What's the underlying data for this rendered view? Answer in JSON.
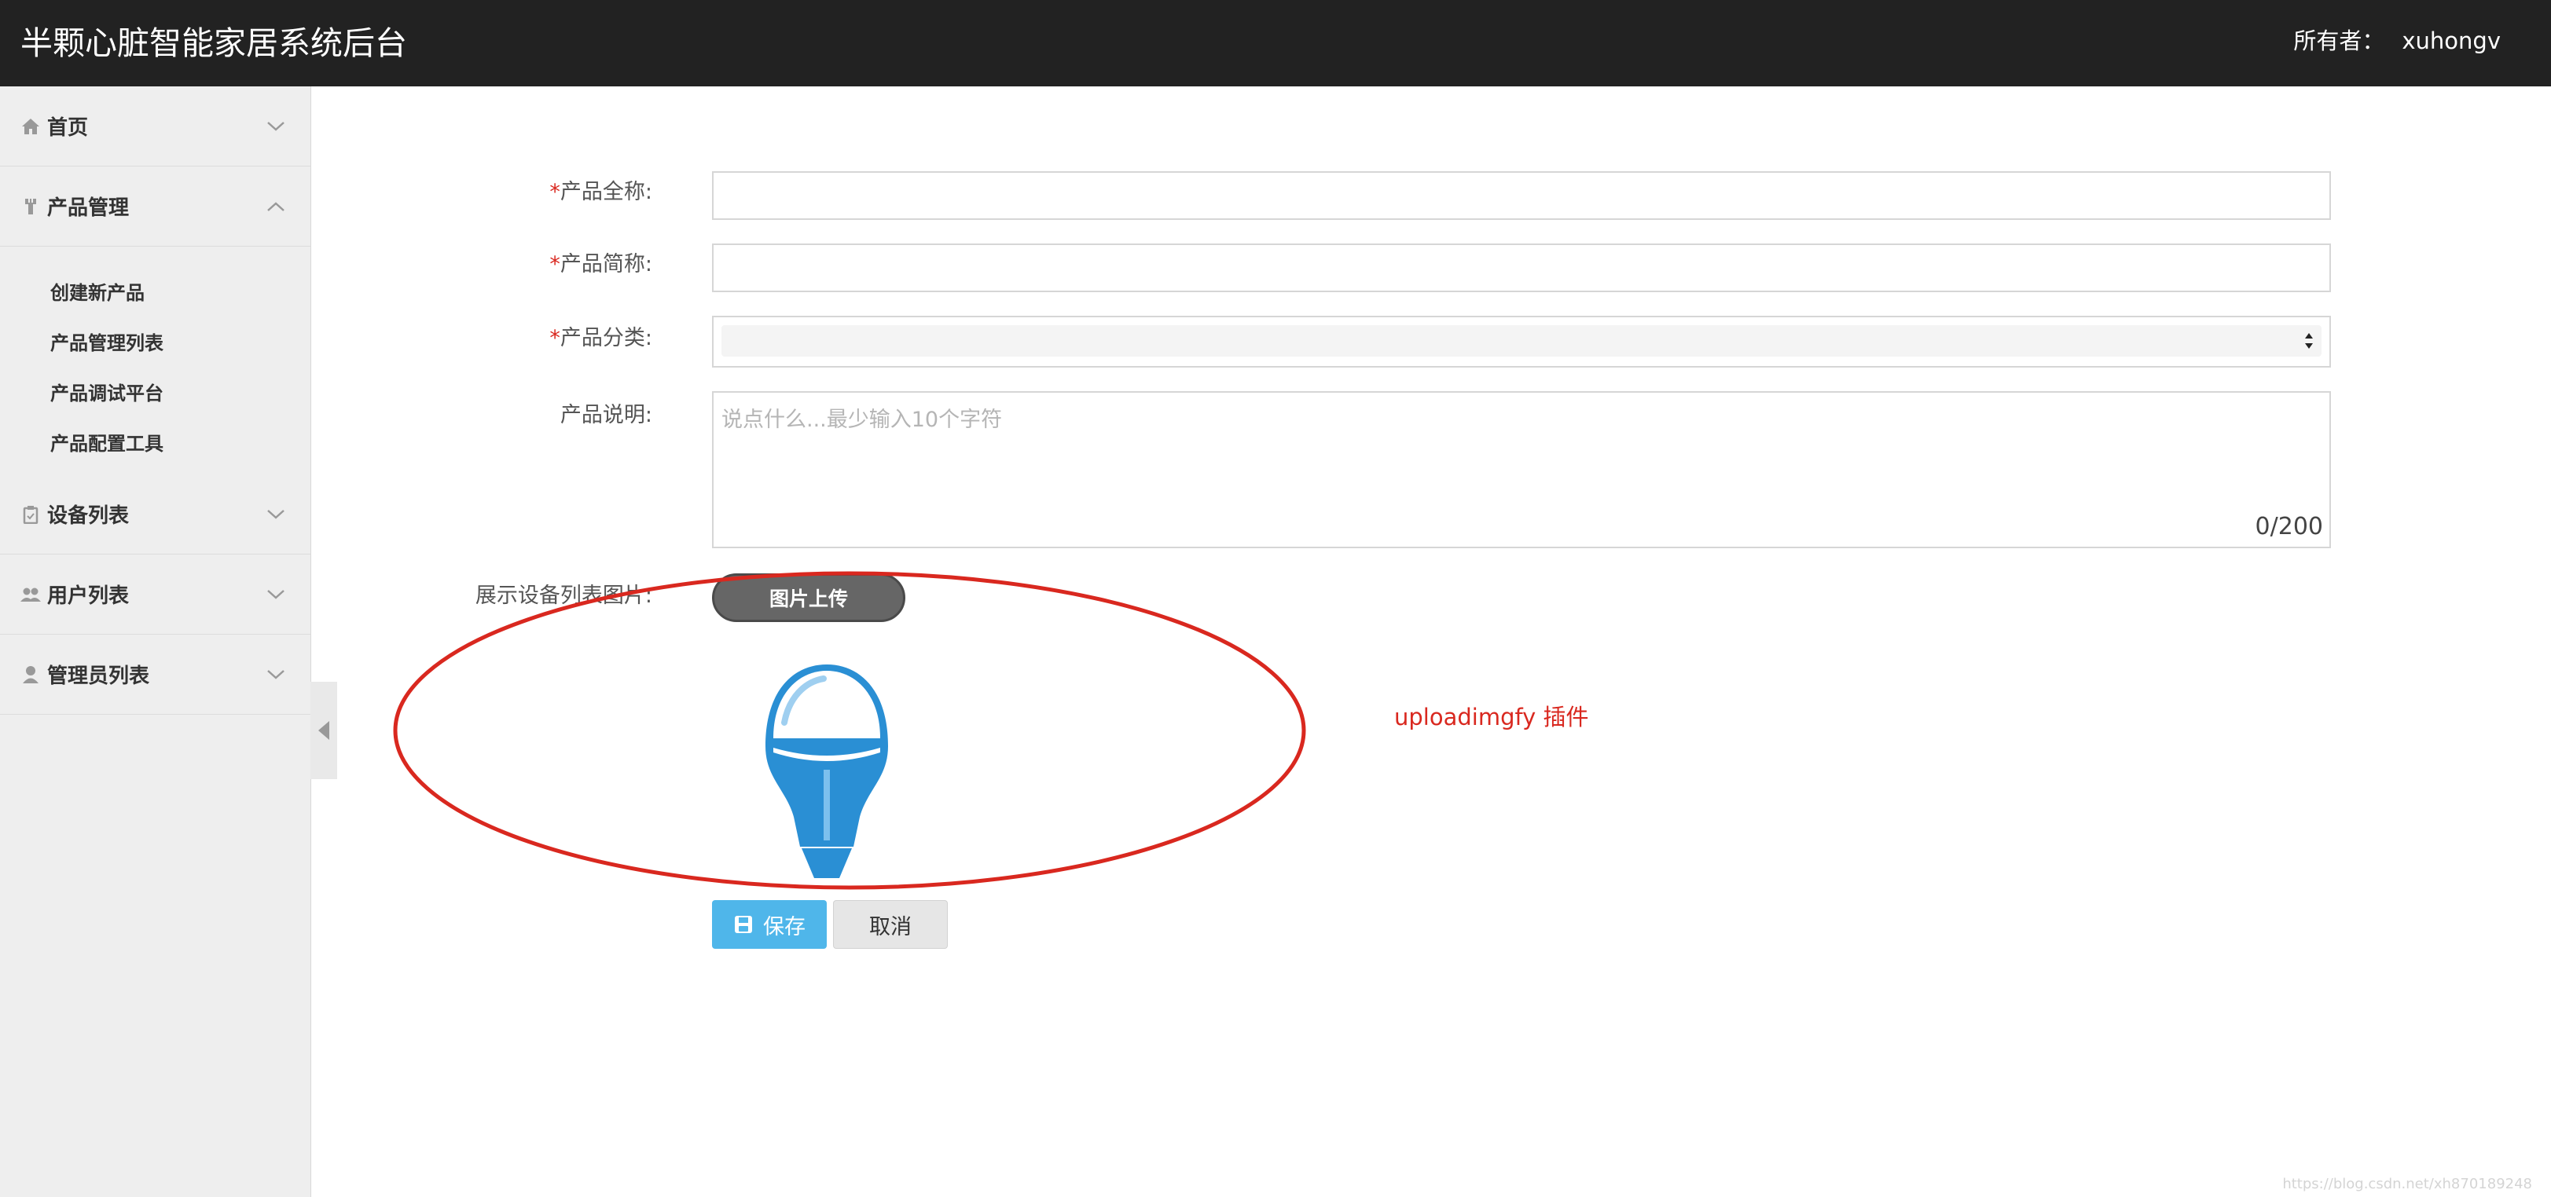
{
  "header": {
    "title": "半颗心脏智能家居系统后台",
    "owner_label": "所有者：",
    "owner_name": "xuhongv"
  },
  "sidebar": {
    "groups": [
      {
        "label": "首页",
        "icon": "home-icon",
        "expanded": false
      },
      {
        "label": "产品管理",
        "icon": "wrench-icon",
        "expanded": true,
        "items": [
          "创建新产品",
          "产品管理列表",
          "产品调试平台",
          "产品配置工具"
        ]
      },
      {
        "label": "设备列表",
        "icon": "clipboard-icon",
        "expanded": false
      },
      {
        "label": "用户列表",
        "icon": "users-icon",
        "expanded": false
      },
      {
        "label": "管理员列表",
        "icon": "user-icon",
        "expanded": false
      }
    ]
  },
  "form": {
    "required_mark": "*",
    "full_name_label": "产品全称:",
    "short_name_label": "产品简称:",
    "category_label": "产品分类:",
    "description_label": "产品说明:",
    "description_placeholder": "说点什么...最少输入10个字符",
    "description_counter": "0/200",
    "image_label": "展示设备列表图片:",
    "upload_button": "图片上传",
    "save_button": "保存",
    "cancel_button": "取消"
  },
  "annotation": {
    "text": "uploadimgfy 插件"
  },
  "watermark": "https://blog.csdn.net/xh870189248",
  "colors": {
    "header_bg": "#222222",
    "sidebar_bg": "#eeeeee",
    "required": "#d9281f",
    "save_button": "#4fb6ea",
    "annotation": "#d9281f",
    "bulb_blue": "#2a8fd4"
  }
}
